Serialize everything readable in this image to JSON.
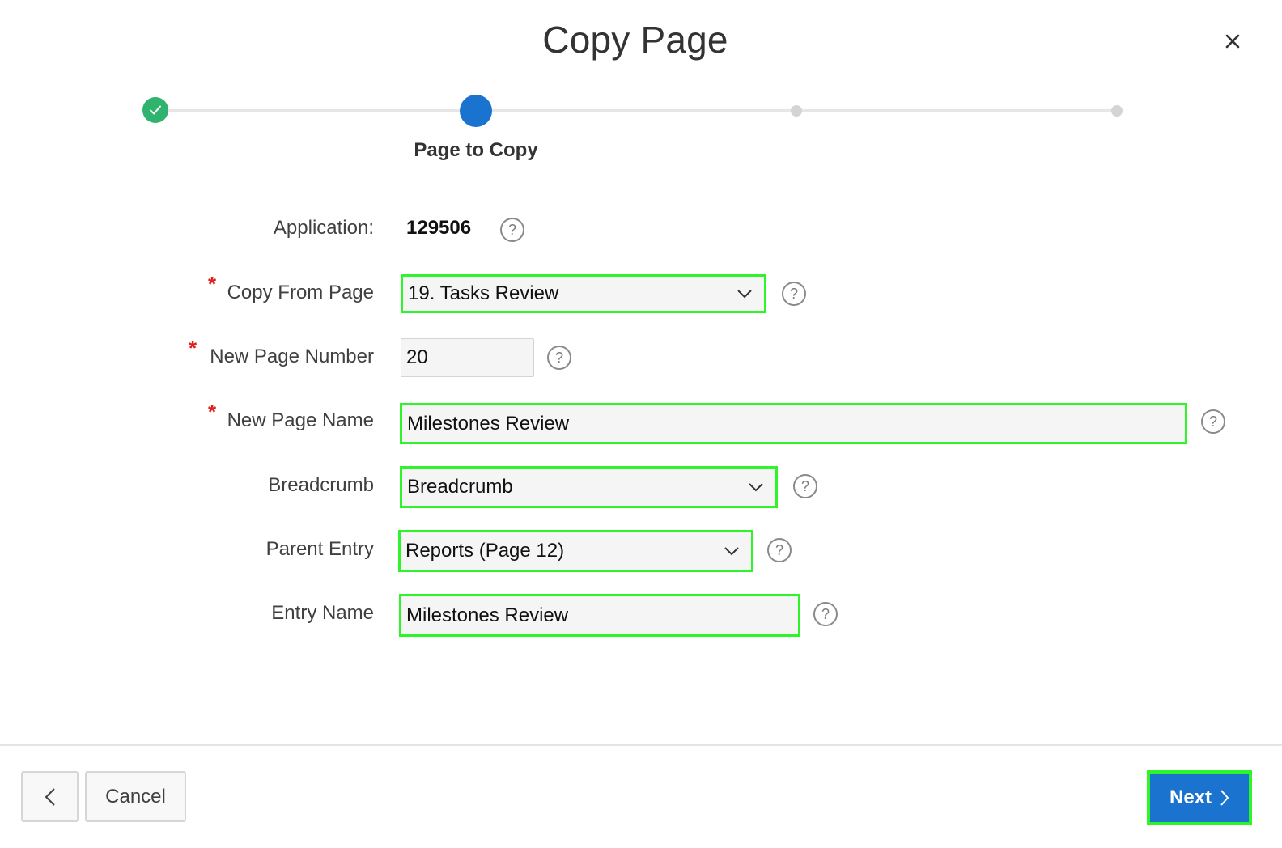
{
  "dialog": {
    "title": "Copy Page",
    "close_icon": "close-icon",
    "close_glyph": "×"
  },
  "wizard": {
    "steps": [
      {
        "status": "complete",
        "label": ""
      },
      {
        "status": "current",
        "label": "Page to Copy"
      },
      {
        "status": "pending",
        "label": ""
      },
      {
        "status": "pending",
        "label": ""
      }
    ],
    "colors": {
      "complete": "#2fb36f",
      "current": "#1a73cf",
      "pending": "#d4d4d4"
    }
  },
  "form": {
    "application": {
      "label": "Application:",
      "value": "129506"
    },
    "copy_from_page": {
      "label": "Copy From Page",
      "required": true,
      "value": "19. Tasks Review"
    },
    "new_page_number": {
      "label": "New Page Number",
      "required": true,
      "value": "20"
    },
    "new_page_name": {
      "label": "New Page Name",
      "required": true,
      "value": "Milestones Review"
    },
    "breadcrumb": {
      "label": "Breadcrumb",
      "value": "Breadcrumb"
    },
    "parent_entry": {
      "label": "Parent Entry",
      "value": "Reports (Page 12)"
    },
    "entry_name": {
      "label": "Entry Name",
      "value": "Milestones Review"
    },
    "required_glyph": "*",
    "help_glyph": "?"
  },
  "footer": {
    "back_icon": "chevron-left-icon",
    "cancel_label": "Cancel",
    "next_label": "Next",
    "next_icon": "chevron-right-icon"
  },
  "colors": {
    "highlight": "#2df52a",
    "primary": "#1a73cf",
    "required": "#e0201b"
  }
}
